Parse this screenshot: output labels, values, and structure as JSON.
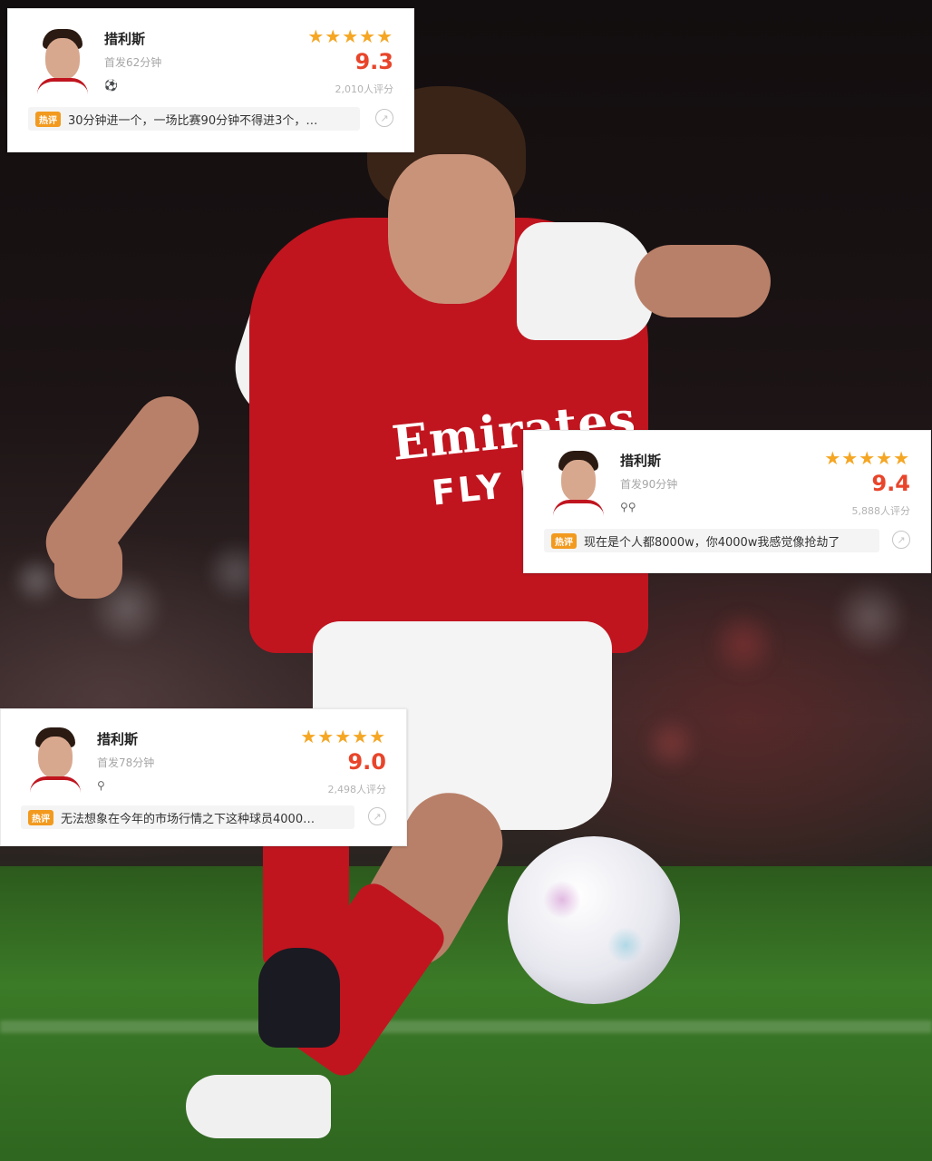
{
  "cards": [
    {
      "player_name": "措利斯",
      "minutes": "首发62分钟",
      "event_icons": "⚽",
      "stars": "★★★★★",
      "score": "9.3",
      "votes": "2,010人评分",
      "tag": "热评",
      "review": "30分钟进一个，一场比赛90分钟不得进3个，…",
      "share_icon": "↗"
    },
    {
      "player_name": "措利斯",
      "minutes": "首发90分钟",
      "event_icons": "⚲⚲",
      "stars": "★★★★★",
      "score": "9.4",
      "votes": "5,888人评分",
      "tag": "热评",
      "review": "现在是个人都8000w，你4000w我感觉像抢劫了",
      "share_icon": "↗"
    },
    {
      "player_name": "措利斯",
      "minutes": "首发78分钟",
      "event_icons": "⚲",
      "stars": "★★★★★",
      "score": "9.0",
      "votes": "2,498人评分",
      "tag": "热评",
      "review": "无法想象在今年的市场行情之下这种球员4000…",
      "share_icon": "↗"
    }
  ],
  "photo": {
    "sponsor": "Emirates",
    "sponsor_sub": "FLY BET"
  },
  "colors": {
    "star": "#f5a623",
    "score": "#e8452b",
    "tag": "#f29a1f",
    "kit_red": "#c0151f"
  }
}
